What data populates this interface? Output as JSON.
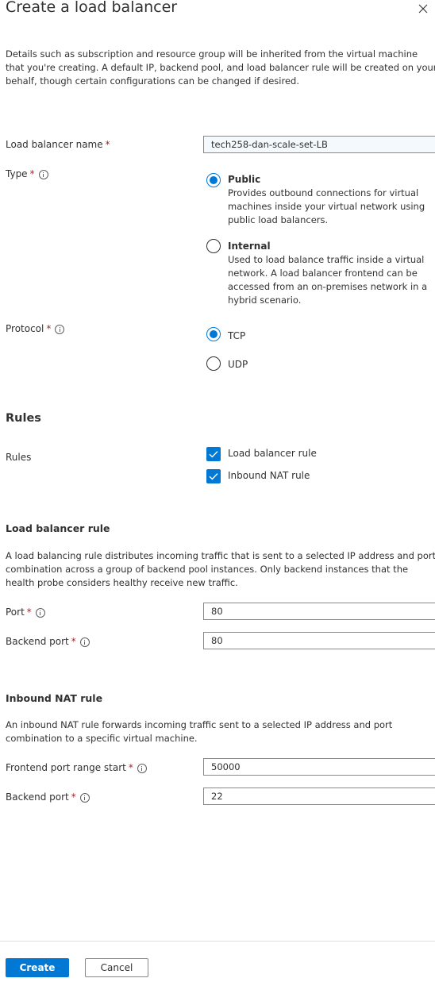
{
  "panel": {
    "title": "Create a load balancer",
    "description": "Details such as subscription and resource group will be inherited from the virtual machine that you're creating. A default IP, backend pool, and load balancer rule will be created on your behalf, though certain configurations can be changed if desired."
  },
  "fields": {
    "name": {
      "label": "Load balancer name",
      "required": "*",
      "value": "tech258-dan-scale-set-LB"
    },
    "type": {
      "label": "Type",
      "required": "*",
      "options": [
        {
          "label": "Public",
          "description": "Provides outbound connections for virtual machines inside your virtual network using public load balancers.",
          "selected": true
        },
        {
          "label": "Internal",
          "description": "Used to load balance traffic inside a virtual network. A load balancer frontend can be accessed from an on-premises network in a hybrid scenario.",
          "selected": false
        }
      ]
    },
    "protocol": {
      "label": "Protocol",
      "required": "*",
      "options": [
        {
          "label": "TCP",
          "selected": true
        },
        {
          "label": "UDP",
          "selected": false
        }
      ]
    }
  },
  "rules": {
    "heading": "Rules",
    "label": "Rules",
    "options": [
      {
        "label": "Load balancer rule",
        "checked": true
      },
      {
        "label": "Inbound NAT rule",
        "checked": true
      }
    ]
  },
  "lb_rule": {
    "heading": "Load balancer rule",
    "description": "A load balancing rule distributes incoming traffic that is sent to a selected IP address and port combination across a group of backend pool instances. Only backend instances that the health probe considers healthy receive new traffic.",
    "port": {
      "label": "Port",
      "required": "*",
      "value": "80"
    },
    "backend_port": {
      "label": "Backend port",
      "required": "*",
      "value": "80"
    }
  },
  "nat_rule": {
    "heading": "Inbound NAT rule",
    "description": "An inbound NAT rule forwards incoming traffic sent to a selected IP address and port combination to a specific virtual machine.",
    "frontend_port_start": {
      "label": "Frontend port range start",
      "required": "*",
      "value": "50000"
    },
    "backend_port": {
      "label": "Backend port",
      "required": "*",
      "value": "22"
    }
  },
  "footer": {
    "create_label": "Create",
    "cancel_label": "Cancel"
  },
  "colors": {
    "accent": "#0078d4",
    "required": "#a4262c",
    "text": "#323130",
    "border": "#8a8886"
  },
  "icons": {
    "close": "close-icon",
    "info": "info-icon",
    "check": "checkmark-icon"
  }
}
